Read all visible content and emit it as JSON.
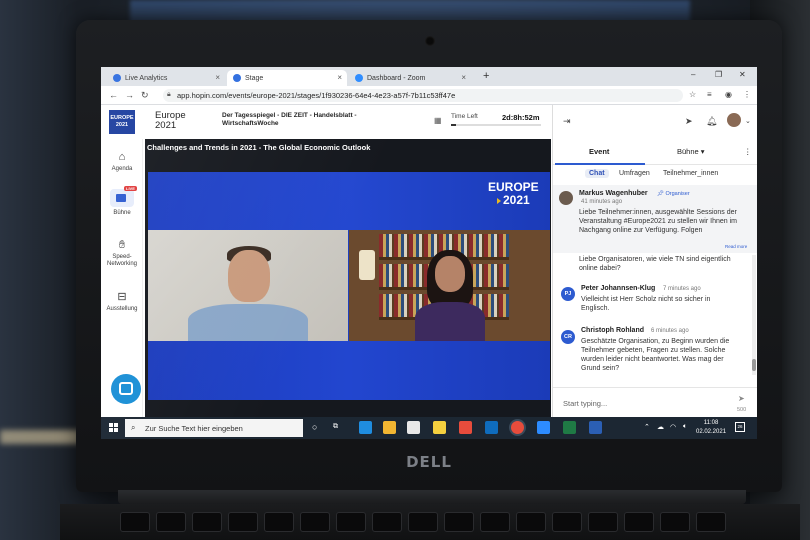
{
  "browser": {
    "tabs": [
      {
        "label": "Live Analytics"
      },
      {
        "label": "Stage"
      },
      {
        "label": "Dashboard - Zoom"
      }
    ],
    "url": "app.hopin.com/events/europe-2021/stages/1f930236-64e4-4e23-a57f-7b11c53ff47e"
  },
  "header": {
    "logo_line1": "EUROPE",
    "logo_line2": "2021",
    "event_title_line1": "Europe",
    "event_title_line2": "2021",
    "sponsors_line1": "Der Tagesspiegel - DIE ZEIT - Handelsblatt -",
    "sponsors_line2": "WirtschaftsWoche",
    "time_left_label": "Time Left",
    "time_left_value": "2d:8h:52m"
  },
  "nav": {
    "items": [
      {
        "label": "Agenda"
      },
      {
        "label": "Bühne",
        "badge": "LIVE"
      },
      {
        "label": "Speed-\nNetworking"
      },
      {
        "label": "Ausstellung"
      }
    ]
  },
  "stage": {
    "title": "Challenges and Trends in 2021 - The Global Economic Outlook",
    "overlay_line1": "EUROPE",
    "overlay_line2": "2021"
  },
  "panel": {
    "tabs": [
      {
        "label": "Event"
      },
      {
        "label": "Bühne"
      }
    ],
    "subtabs": [
      {
        "label": "Chat"
      },
      {
        "label": "Umfragen"
      },
      {
        "label": "Teilnehmer_innen"
      }
    ],
    "pinned": {
      "name": "Markus Wagenhuber",
      "role": "Organiser",
      "time": "41 minutes ago",
      "text": "Liebe Teilnehmer:innen, ausgewählte Sessions der Veranstaltung #Europe2021 zu stellen wir Ihnen im Nachgang online zur Verfügung. Folgen",
      "read_more": "Read more"
    },
    "partial_text": "Liebe Organisatoren, wie viele TN sind eigentlich online dabei?",
    "messages": [
      {
        "initials": "PJ",
        "name": "Peter Johannsen-Klug",
        "time": "7 minutes ago",
        "text": "Vielleicht ist Herr Scholz nicht so sicher in Englisch.",
        "color": "#2d5bd0"
      },
      {
        "initials": "CR",
        "name": "Christoph Rohland",
        "time": "6 minutes ago",
        "text": "Geschätzte Organisation, zu Beginn wurden die Teilnehmer gebeten, Fragen zu stellen. Solche wurden leider nicht beantwortet. Was mag der Grund sein?",
        "color": "#2d5bd0"
      }
    ],
    "input_placeholder": "Start typing...",
    "char_count": "500"
  },
  "taskbar": {
    "search_placeholder": "Zur Suche Text hier eingeben",
    "time": "11:08",
    "date": "02.02.2021",
    "notif_count": "26"
  },
  "laptop": {
    "brand": "DELL"
  }
}
